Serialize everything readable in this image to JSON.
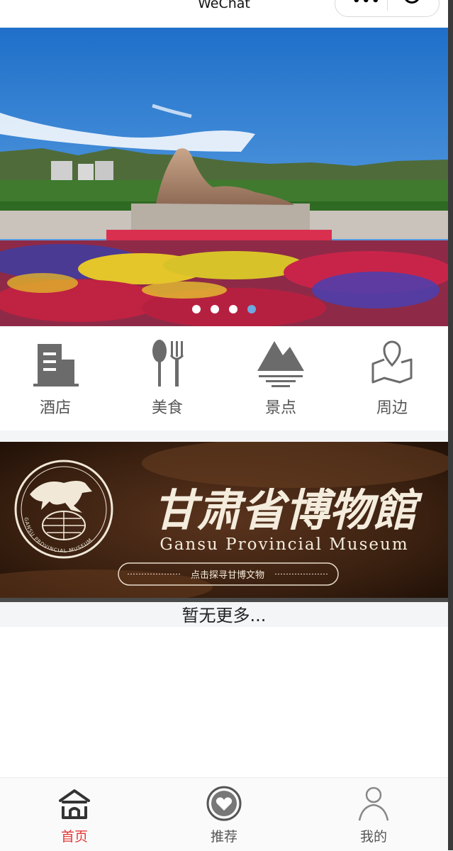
{
  "navbar": {
    "title": "WeChat"
  },
  "banner": {
    "slide_count": 4,
    "active_index": 3
  },
  "categories": [
    {
      "label": "酒店",
      "icon": "building-icon"
    },
    {
      "label": "美食",
      "icon": "spoon-fork-icon"
    },
    {
      "label": "景点",
      "icon": "mountain-icon"
    },
    {
      "label": "周边",
      "icon": "map-pin-icon"
    }
  ],
  "museum": {
    "title_cn": "甘肃省博物館",
    "title_en": "Gansu Provincial Museum",
    "button": "点击探寻甘博文物",
    "seal_text": "GANSU PROVINCIAL MUSEUM"
  },
  "list_footer": "暂无更多...",
  "tabbar": {
    "tabs": [
      {
        "label": "首页",
        "icon": "home-icon",
        "active": true
      },
      {
        "label": "推荐",
        "icon": "heart-icon",
        "active": false
      },
      {
        "label": "我的",
        "icon": "user-icon",
        "active": false
      }
    ]
  },
  "colors": {
    "active": "#e53935",
    "dot_active": "#6fa8e0",
    "icon_gray": "#6b6b6b"
  }
}
